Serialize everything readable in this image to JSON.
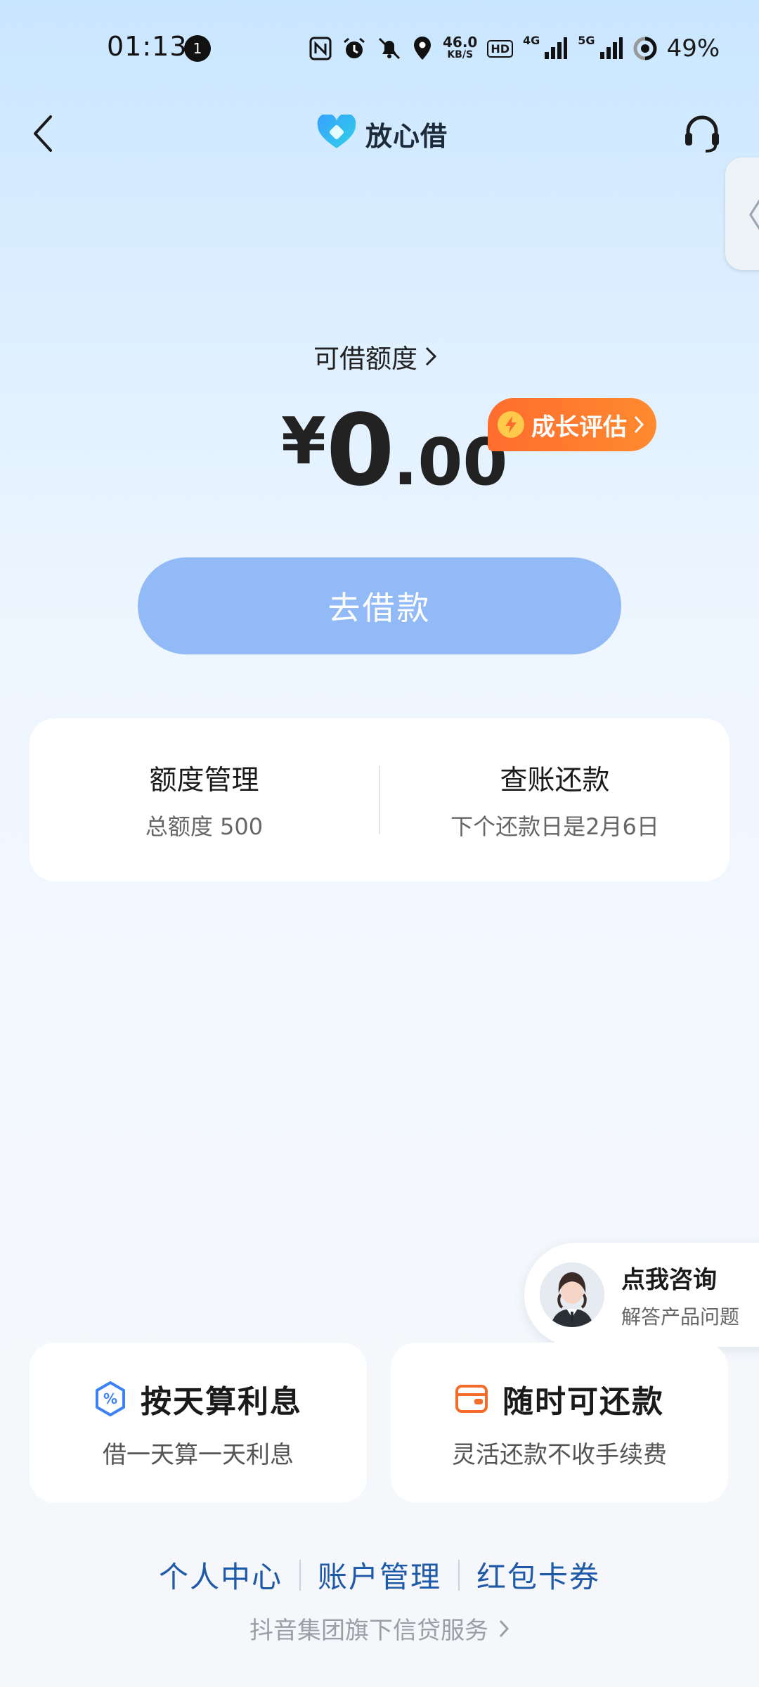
{
  "status_bar": {
    "time": "01:13",
    "notification_count": "1",
    "net_speed_value": "46.0",
    "net_speed_unit": "KB/S",
    "hd_label": "HD",
    "network_4g": "4G",
    "network_5g": "5G",
    "battery": "49%"
  },
  "header": {
    "app_title": "放心借",
    "back_icon": "chevron-left-icon",
    "support_icon": "headset-icon",
    "side_tab_glyph": "〈"
  },
  "credit": {
    "label": "可借额度",
    "currency": "¥",
    "amount_int": "0",
    "amount_dec": ".00",
    "growth_badge": "成长评估"
  },
  "borrow_button": "去借款",
  "manage": {
    "left_title": "额度管理",
    "left_sub": "总额度 500",
    "right_title": "查账还款",
    "right_sub": "下个还款日是2月6日"
  },
  "consult": {
    "title": "点我咨询",
    "subtitle": "解答产品问题"
  },
  "features": [
    {
      "title": "按天算利息",
      "subtitle": "借一天算一天利息",
      "icon": "percent-shield-icon"
    },
    {
      "title": "随时可还款",
      "subtitle": "灵活还款不收手续费",
      "icon": "wallet-icon"
    }
  ],
  "footer": {
    "links": [
      "个人中心",
      "账户管理",
      "红包卡券"
    ],
    "note": "抖音集团旗下信贷服务"
  },
  "colors": {
    "accent_blue": "#92baf7",
    "badge_orange": "#ff7a2f",
    "link_blue": "#1e5aa8"
  }
}
